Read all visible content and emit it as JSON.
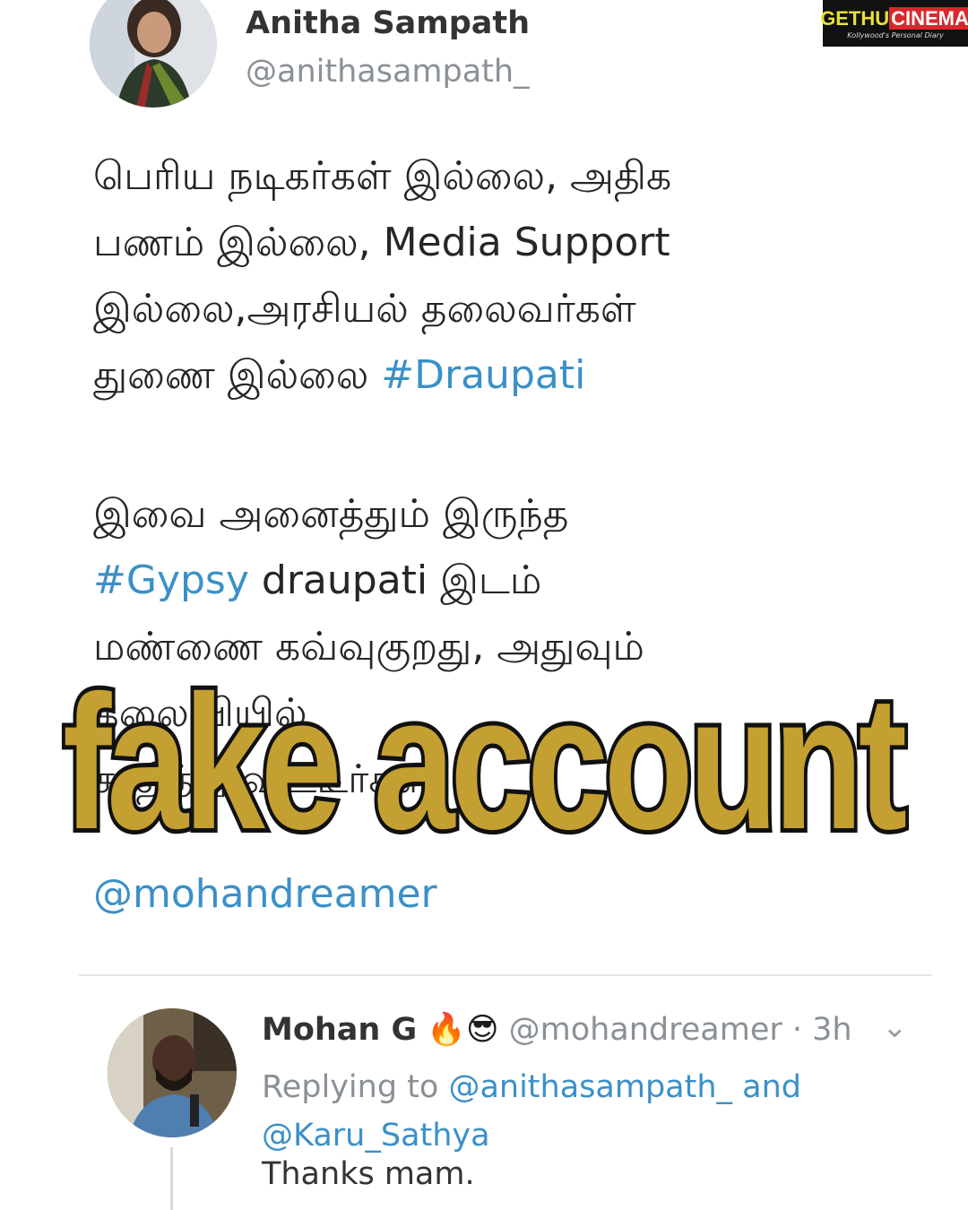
{
  "tweet": {
    "author_name": "Anitha Sampath",
    "author_handle": "@anithasampath_",
    "para1_lines": [
      "பெரிய நடிகர்கள் இல்லை, அதிக",
      "பணம் இல்லை, Media Support",
      "இல்லை,அரசியல் தலைவர்கள்",
      "துணை இல்லை"
    ],
    "hashtag_draupati": "#Draupati",
    "para2_line1": "இவை அனைத்தும் இருந்த",
    "hashtag_gypsy": "#Gypsy",
    "para2_line2_rest": " draupati இடம்",
    "para2_line3": "மண்ணை கவ்வுகுறது, அதுவும்",
    "para2_line4": "தலைவியில்",
    "para2_line5": "சாதித்து விட்டீர்கள்",
    "mention": "@mohandreamer"
  },
  "overlay_text": "fake account",
  "reply": {
    "author_name": "Mohan G",
    "emojis": "🔥😎",
    "handle_time": "@mohandreamer · 3h",
    "replying_prefix": "Replying to ",
    "replying_to_1": "@anithasampath_ and",
    "replying_to_2": "@Karu_Sathya",
    "body": "Thanks mam."
  },
  "watermark": {
    "brand_part1": "GETHU",
    "brand_part2": "CINEMA",
    "tagline": "Kollywood's Personal Diary"
  },
  "icons": {
    "menu": "chevron-down-icon"
  }
}
